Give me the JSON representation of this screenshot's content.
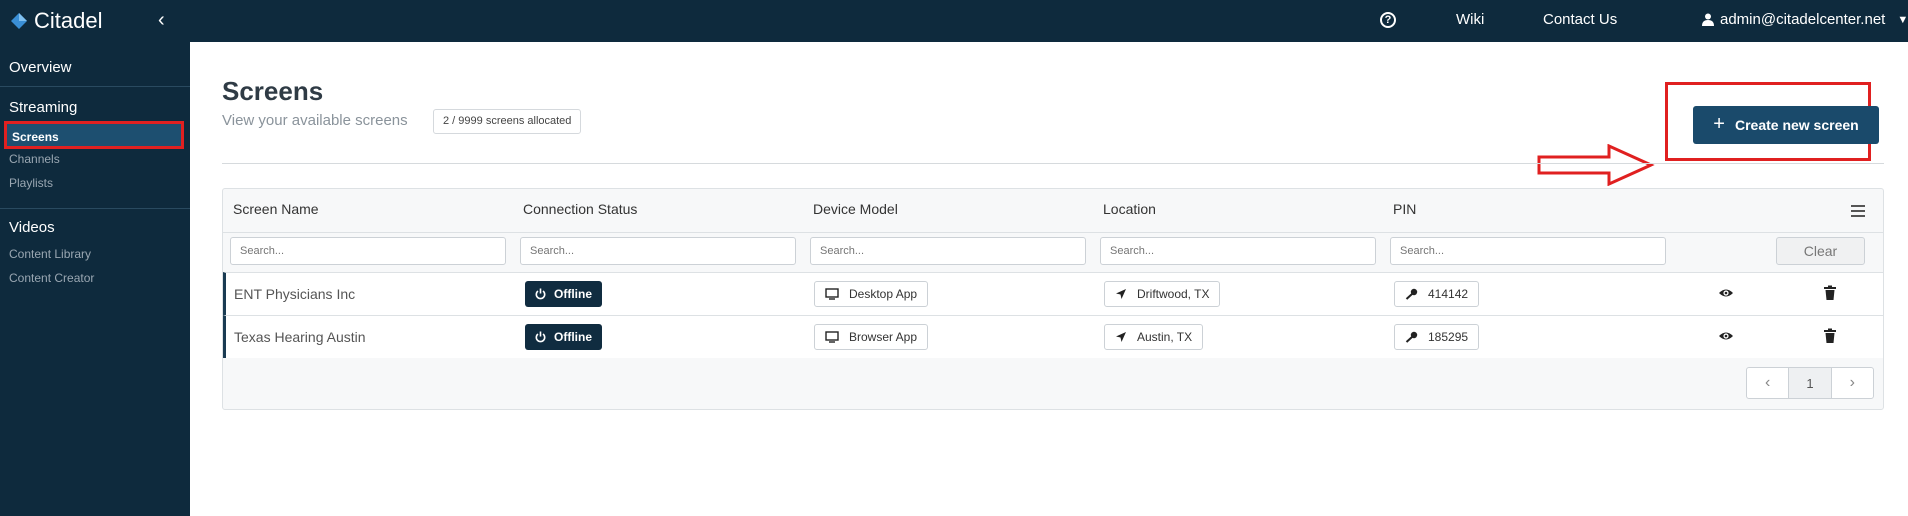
{
  "app": {
    "name": "Citadel",
    "colors": {
      "navy": "#0e2a3d",
      "primary_button": "#1a4a6b",
      "highlight": "#e02020"
    }
  },
  "topnav": {
    "wiki": "Wiki",
    "contact": "Contact Us",
    "user_email": "admin@citadelcenter.net"
  },
  "sidebar": {
    "overview": "Overview",
    "streaming": "Streaming",
    "streaming_items": [
      "Screens",
      "Channels",
      "Playlists"
    ],
    "videos": "Videos",
    "videos_items": [
      "Content Library",
      "Content Creator"
    ]
  },
  "page": {
    "title": "Screens",
    "subtitle": "View your available screens",
    "allocation": "2 / 9999 screens allocated",
    "create_button": "Create new screen"
  },
  "table": {
    "columns": [
      "Screen Name",
      "Connection Status",
      "Device Model",
      "Location",
      "PIN"
    ],
    "filter_placeholder": "Search...",
    "clear_label": "Clear",
    "rows": [
      {
        "name": "ENT Physicians Inc",
        "status": "Offline",
        "device": "Desktop App",
        "location": "Driftwood, TX",
        "pin": "414142"
      },
      {
        "name": "Texas Hearing Austin",
        "status": "Offline",
        "device": "Browser App",
        "location": "Austin, TX",
        "pin": "185295"
      }
    ],
    "page_number": "1"
  }
}
